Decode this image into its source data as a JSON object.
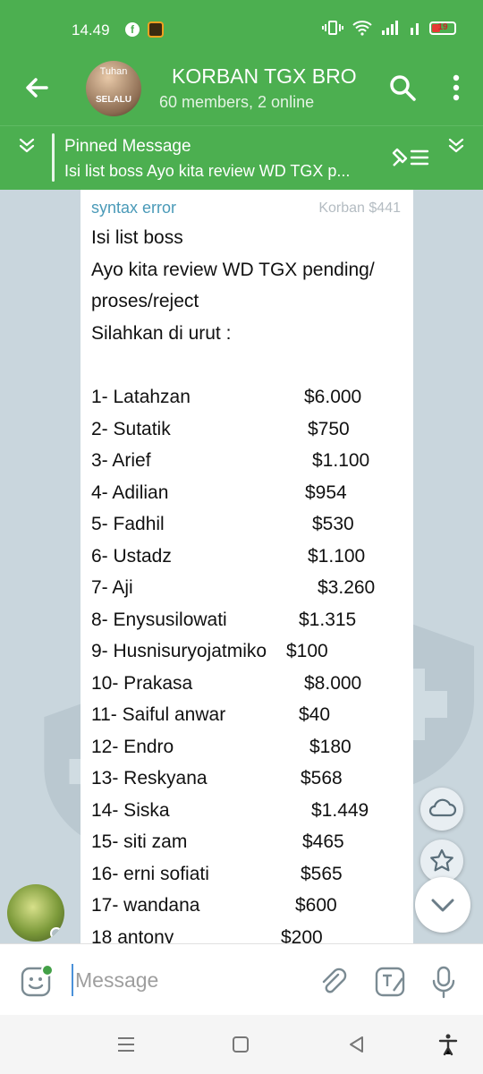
{
  "status_bar": {
    "time": "14.49",
    "battery": "19"
  },
  "header": {
    "title": "KORBAN TGX BRO",
    "subtitle": "60 members, 2 online",
    "avatar_line1": "Tuhan",
    "avatar_line2": "SELALU"
  },
  "pinned": {
    "label": "Pinned Message",
    "text": "Isi list boss Ayo kita review WD TGX p..."
  },
  "message": {
    "sender": "syntax error",
    "rank": "Korban $441",
    "intro": [
      "Isi list boss",
      "Ayo kita review WD TGX pending/",
      "proses/reject",
      "Silahkan di urut :"
    ],
    "list": [
      {
        "name": "1- Latahzan",
        "amount": "$6.000"
      },
      {
        "name": "2- Sutatik",
        "amount": "$750"
      },
      {
        "name": "3- Arief",
        "amount": "$1.100"
      },
      {
        "name": "4- Adilian",
        "amount": "$954"
      },
      {
        "name": "5- Fadhil",
        "amount": "$530"
      },
      {
        "name": "6- Ustadz",
        "amount": "$1.100"
      },
      {
        "name": "7- Aji",
        "amount": "$3.260"
      },
      {
        "name": "8- Enysusilowati",
        "amount": "$1.315"
      },
      {
        "name": "9- Husnisuryojatmiko",
        "amount": "$100"
      },
      {
        "name": "10- Prakasa",
        "amount": "$8.000"
      },
      {
        "name": "11- Saiful anwar",
        "amount": "$40"
      },
      {
        "name": "12- Endro",
        "amount": "$180"
      },
      {
        "name": "13- Reskyana",
        "amount": "$568"
      },
      {
        "name": "14- Siska",
        "amount": "$1.449"
      },
      {
        "name": "15- siti zam",
        "amount": "$465"
      },
      {
        "name": "16- erni sofiati",
        "amount": "$565"
      },
      {
        "name": "17- wandana",
        "amount": "$600"
      },
      {
        "name": "18 antony",
        "amount": "$200"
      }
    ]
  },
  "composer": {
    "placeholder": "Message"
  },
  "colors": {
    "accent": "#4caf50",
    "chat_bg": "#c9d6dd",
    "sender": "#4a9ab8"
  }
}
